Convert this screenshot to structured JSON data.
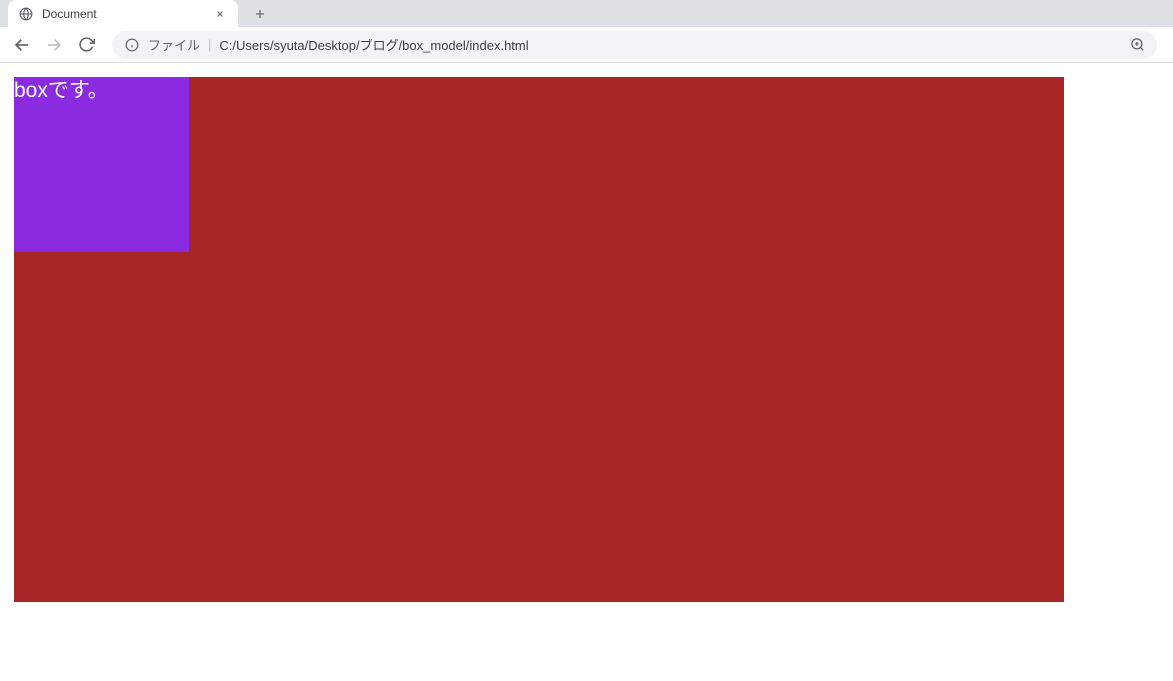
{
  "browser": {
    "tab": {
      "title": "Document"
    },
    "address": {
      "file_label": "ファイル",
      "path": "C:/Users/syuta/Desktop/ブログ/box_model/index.html"
    }
  },
  "page": {
    "box_text": "boxです。"
  }
}
